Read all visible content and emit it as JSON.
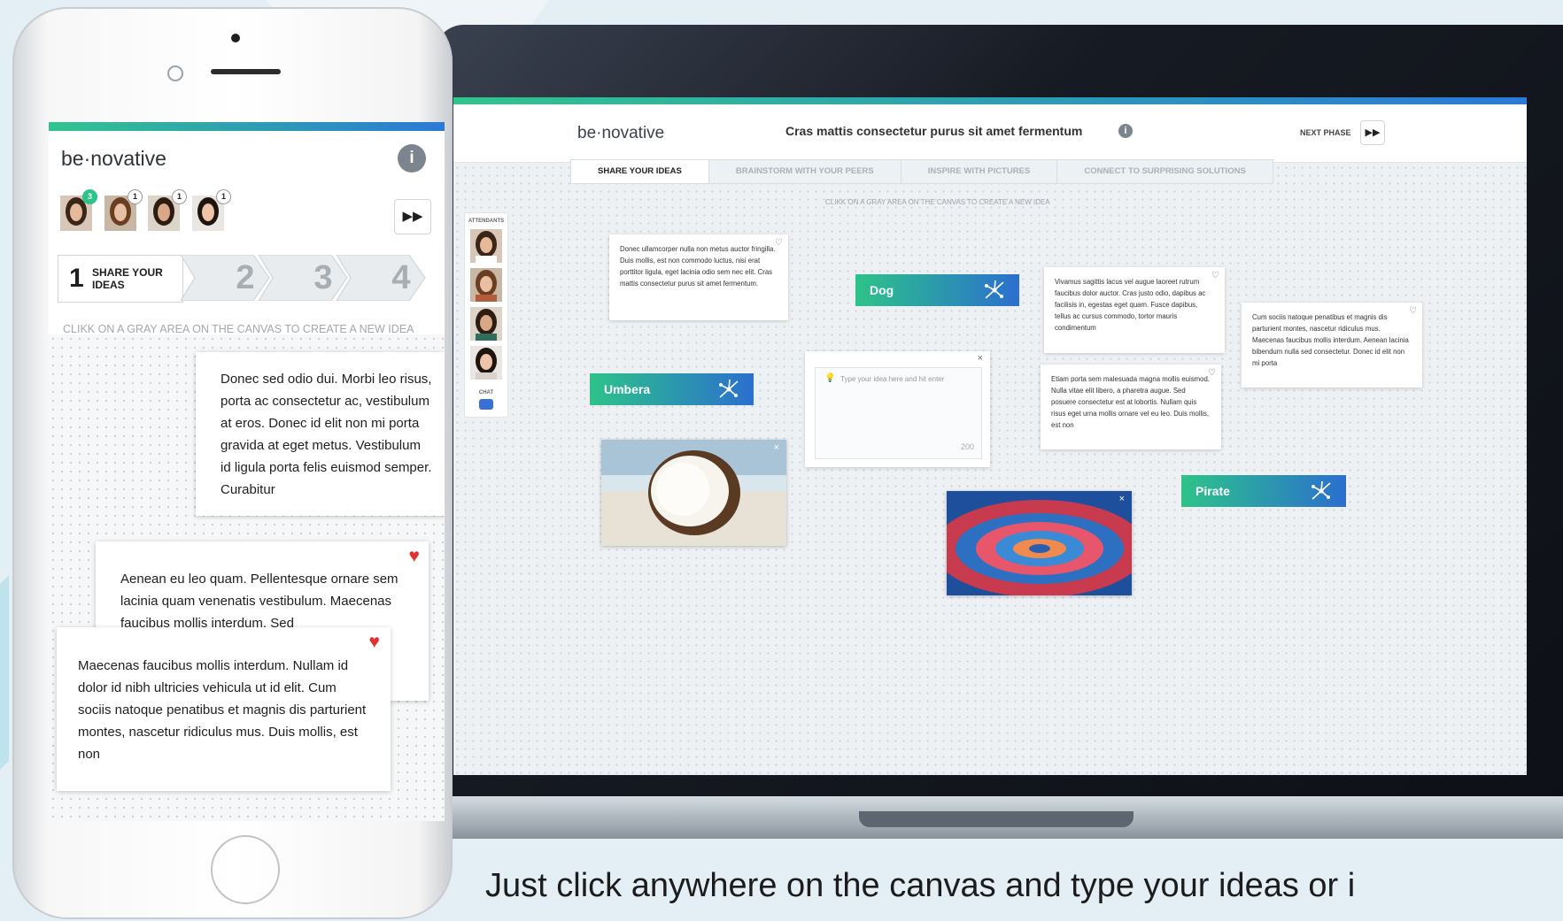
{
  "colors": {
    "accent_green": "#2dc38a",
    "accent_blue": "#2b6fcf",
    "heart_red": "#e03131"
  },
  "desktop": {
    "logo": "be·novative",
    "title": "Cras mattis consectetur purus sit amet fermentum",
    "info_icon": "info-icon",
    "next_phase_label": "NEXT PHASE",
    "next_icon": "fast-forward-icon",
    "tabs": [
      {
        "label": "SHARE YOUR IDEAS"
      },
      {
        "label": "BRAINSTORM WITH YOUR PEERS"
      },
      {
        "label": "INSPIRE WITH PICTURES"
      },
      {
        "label": "CONNECT TO SURPRISING SOLUTIONS"
      }
    ],
    "hint": "CLIKK ON A GRAY AREA ON THE CANVAS TO CREATE A NEW IDEA",
    "attendants_label": "ATTENDANTS",
    "chat_label": "CHAT",
    "cards": [
      {
        "text": "Donec ullamcorper nulla non metus auctor fringilla. Duis mollis, est non commodo luctus, nisi erat porttitor ligula, eget lacinia odio sem nec elit. Cras mattis consectetur purus sit amet fermentum."
      },
      {
        "text": "Vivamus sagittis lacus vel augue laoreet rutrum faucibus dolor auctor. Cras justo odio, dapibus ac facilisis in, egestas eget quam. Fusce dapibus, tellus ac cursus commodo, tortor mauris condimentum"
      },
      {
        "text": "Cum sociis natoque penatibus et magnis dis parturient montes, nascetur ridiculus mus. Maecenas faucibus mollis interdum. Aenean lacinia bibendum nulla sed consectetur. Donec id elit non mi porta"
      },
      {
        "text": "Etiam porta sem malesuada magna mollis euismod. Nulla vitae elit libero, a pharetra augue. Sed posuere consectetur est at lobortis. Nullam quis risus eget urna mollis ornare vel eu leo. Duis mollis, est non"
      }
    ],
    "tags": [
      {
        "label": "Dog"
      },
      {
        "label": "Umbera"
      },
      {
        "label": "Pirate"
      }
    ],
    "new_idea": {
      "placeholder": "Type your idea here and hit enter",
      "counter": "200"
    }
  },
  "phone": {
    "logo": "be·novative",
    "badges": [
      "3",
      "1",
      "1",
      "1"
    ],
    "step1_num": "1",
    "step1_label": "SHARE YOUR IDEAS",
    "steps": [
      "2",
      "3",
      "4"
    ],
    "hint": "CLIKK ON A GRAY AREA ON THE CANVAS TO CREATE A NEW IDEA",
    "cards": [
      {
        "text": "Donec sed odio dui. Morbi leo risus, porta ac consectetur ac, vestibulum at eros. Donec id elit non mi porta gravida at eget metus. Vestibulum id ligula porta felis euismod semper. Curabitur"
      },
      {
        "text": "Aenean eu leo quam. Pellentesque ornare sem lacinia quam venenatis vestibulum. Maecenas faucibus mollis interdum. Sed"
      },
      {
        "text": "Maecenas faucibus mollis interdum. Nullam id dolor id nibh ultricies vehicula ut id elit. Cum sociis natoque penatibus et magnis dis parturient montes, nascetur ridiculus mus. Duis mollis, est non"
      }
    ]
  },
  "caption": "Just click anywhere on the canvas and type your ideas or i"
}
